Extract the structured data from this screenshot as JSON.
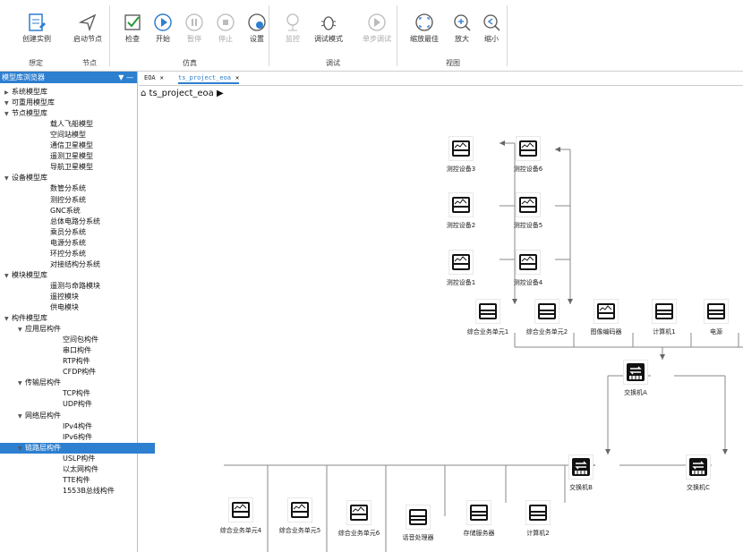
{
  "ribbon": {
    "buttons": [
      {
        "label": "创建实例",
        "icon": "create-instance-icon",
        "disabled": false
      },
      {
        "label": "启动节点",
        "icon": "send-icon",
        "disabled": false
      },
      {
        "label": "检查",
        "icon": "check-icon",
        "disabled": false
      },
      {
        "label": "开始",
        "icon": "play-icon",
        "disabled": false
      },
      {
        "label": "暂停",
        "icon": "pause-icon",
        "disabled": true
      },
      {
        "label": "停止",
        "icon": "stop-icon",
        "disabled": true
      },
      {
        "label": "设置",
        "icon": "settings-icon",
        "disabled": false
      },
      {
        "label": "监控",
        "icon": "monitor-icon",
        "disabled": true
      },
      {
        "label": "调试模式",
        "icon": "bug-icon",
        "disabled": false
      },
      {
        "label": "单步调试",
        "icon": "step-icon",
        "disabled": true
      },
      {
        "label": "缩放最佳",
        "icon": "zoom-fit-icon",
        "disabled": false
      },
      {
        "label": "放大",
        "icon": "zoom-in-icon",
        "disabled": false
      },
      {
        "label": "缩小",
        "icon": "zoom-out-icon",
        "disabled": false
      }
    ],
    "groups": [
      "想定",
      "节点",
      "仿真",
      "调试",
      "视图"
    ]
  },
  "panel": {
    "title": "模型库浏览器",
    "tree": [
      {
        "label": "系统模型库",
        "lvl": 0,
        "arrow": "right"
      },
      {
        "label": "可重用模型库",
        "lvl": 0,
        "arrow": "down"
      },
      {
        "label": "节点模型库",
        "lvl": 1,
        "arrow": "down"
      },
      {
        "label": "载人飞船模型",
        "lvl": 3
      },
      {
        "label": "空间站模型",
        "lvl": 3
      },
      {
        "label": "通信卫星模型",
        "lvl": 3
      },
      {
        "label": "遥测卫星模型",
        "lvl": 3
      },
      {
        "label": "导航卫星模型",
        "lvl": 3
      },
      {
        "label": "设备模型库",
        "lvl": 1,
        "arrow": "down"
      },
      {
        "label": "数管分系统",
        "lvl": 3
      },
      {
        "label": "测控分系统",
        "lvl": 3
      },
      {
        "label": "GNC系统",
        "lvl": 3
      },
      {
        "label": "总体电路分系统",
        "lvl": 3
      },
      {
        "label": "乘员分系统",
        "lvl": 3
      },
      {
        "label": "电源分系统",
        "lvl": 3
      },
      {
        "label": "环控分系统",
        "lvl": 3
      },
      {
        "label": "对接结构分系统",
        "lvl": 3
      },
      {
        "label": "模块模型库",
        "lvl": 1,
        "arrow": "down"
      },
      {
        "label": "遥测与命路模块",
        "lvl": 3
      },
      {
        "label": "遥控模块",
        "lvl": 3
      },
      {
        "label": "供电模块",
        "lvl": 3
      },
      {
        "label": "构件模型库",
        "lvl": 1,
        "arrow": "down"
      },
      {
        "label": "应用层构件",
        "lvl": 2,
        "arrow": "down"
      },
      {
        "label": "空间包构件",
        "lvl": 4
      },
      {
        "label": "串口构件",
        "lvl": 4
      },
      {
        "label": "RTP构件",
        "lvl": 4
      },
      {
        "label": "CFDP构件",
        "lvl": 4
      },
      {
        "label": "传输层构件",
        "lvl": 2,
        "arrow": "down"
      },
      {
        "label": "TCP构件",
        "lvl": 4
      },
      {
        "label": "UDP构件",
        "lvl": 4
      },
      {
        "label": "网络层构件",
        "lvl": 2,
        "arrow": "down"
      },
      {
        "label": "IPv4构件",
        "lvl": 4
      },
      {
        "label": "IPv6构件",
        "lvl": 4
      },
      {
        "label": "链路层构件",
        "lvl": 2,
        "arrow": "down",
        "selected": true
      },
      {
        "label": "USLP构件",
        "lvl": 4
      },
      {
        "label": "以太网构件",
        "lvl": 4
      },
      {
        "label": "TTE构件",
        "lvl": 4
      },
      {
        "label": "1553B总线构件",
        "lvl": 4
      }
    ]
  },
  "tabs": [
    {
      "label": "EOA",
      "active": false
    },
    {
      "label": "ts_project_eoa",
      "active": true
    }
  ],
  "breadcrumb": "ts_project_eoa",
  "devices": [
    {
      "id": "mk3",
      "label": "测控设备3",
      "type": "device"
    },
    {
      "id": "mk6",
      "label": "测控设备6",
      "type": "device"
    },
    {
      "id": "mk2",
      "label": "测控设备2",
      "type": "device"
    },
    {
      "id": "mk5",
      "label": "测控设备5",
      "type": "device"
    },
    {
      "id": "mk1",
      "label": "测控设备1",
      "type": "device"
    },
    {
      "id": "mk4",
      "label": "测控设备4",
      "type": "device"
    },
    {
      "id": "zh1",
      "label": "综合业务单元1",
      "type": "server"
    },
    {
      "id": "zh2",
      "label": "综合业务单元2",
      "type": "server"
    },
    {
      "id": "img",
      "label": "图像编码器",
      "type": "device"
    },
    {
      "id": "pc1",
      "label": "计算机1",
      "type": "server"
    },
    {
      "id": "pw",
      "label": "电源",
      "type": "server"
    },
    {
      "id": "swA",
      "label": "交换机A",
      "type": "switch"
    },
    {
      "id": "swB",
      "label": "交换机B",
      "type": "switch"
    },
    {
      "id": "swC",
      "label": "交换机C",
      "type": "switch"
    },
    {
      "id": "zh4",
      "label": "综合业务单元4",
      "type": "device"
    },
    {
      "id": "zh5",
      "label": "综合业务单元5",
      "type": "device"
    },
    {
      "id": "zh6",
      "label": "综合业务单元6",
      "type": "device"
    },
    {
      "id": "voice",
      "label": "话音处理器",
      "type": "server"
    },
    {
      "id": "store",
      "label": "存储服务器",
      "type": "server"
    },
    {
      "id": "pc2",
      "label": "计算机2",
      "type": "server"
    }
  ],
  "colors": {
    "accent": "#2d7fd0",
    "wire": "#888888"
  }
}
